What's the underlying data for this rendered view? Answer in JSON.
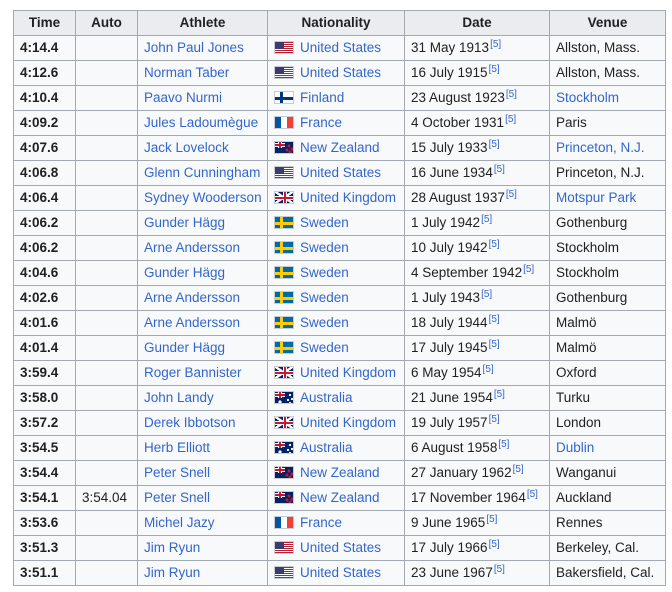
{
  "colors": {
    "header_bg": "#eaecf0",
    "cell_bg": "#f8f9fa",
    "border": "#a2a9b1",
    "link": "#3366cc",
    "text": "#202122"
  },
  "table": {
    "headers": [
      "Time",
      "Auto",
      "Athlete",
      "Nationality",
      "Date",
      "Venue"
    ],
    "rows": [
      {
        "time": "4:14.4",
        "auto": "",
        "athlete": "John Paul Jones",
        "nationality": "United States",
        "flag": "flag-us",
        "date": "31 May 1913",
        "ref": "[5]",
        "venue": "Allston, Mass.",
        "venue_link": false
      },
      {
        "time": "4:12.6",
        "auto": "",
        "athlete": "Norman Taber",
        "nationality": "United States",
        "flag": "flag-us",
        "date": "16 July 1915",
        "ref": "[5]",
        "venue": "Allston, Mass.",
        "venue_link": false
      },
      {
        "time": "4:10.4",
        "auto": "",
        "athlete": "Paavo Nurmi",
        "nationality": "Finland",
        "flag": "flag-fi",
        "date": "23 August 1923",
        "ref": "[5]",
        "venue": "Stockholm",
        "venue_link": true
      },
      {
        "time": "4:09.2",
        "auto": "",
        "athlete": "Jules Ladoumègue",
        "nationality": "France",
        "flag": "flag-fr",
        "date": "4 October 1931",
        "ref": "[5]",
        "venue": "Paris",
        "venue_link": false
      },
      {
        "time": "4:07.6",
        "auto": "",
        "athlete": "Jack Lovelock",
        "nationality": "New Zealand",
        "flag": "flag-nz",
        "date": "15 July 1933",
        "ref": "[5]",
        "venue": "Princeton, N.J.",
        "venue_link": true
      },
      {
        "time": "4:06.8",
        "auto": "",
        "athlete": "Glenn Cunningham",
        "nationality": "United States",
        "flag": "flag-us",
        "date": "16 June 1934",
        "ref": "[5]",
        "venue": "Princeton, N.J.",
        "venue_link": false
      },
      {
        "time": "4:06.4",
        "auto": "",
        "athlete": "Sydney Wooderson",
        "nationality": "United Kingdom",
        "flag": "flag-gb",
        "date": "28 August 1937",
        "ref": "[5]",
        "venue": "Motspur Park",
        "venue_link": true
      },
      {
        "time": "4:06.2",
        "auto": "",
        "athlete": "Gunder Hägg",
        "nationality": "Sweden",
        "flag": "flag-se",
        "date": "1 July 1942",
        "ref": "[5]",
        "venue": "Gothenburg",
        "venue_link": false
      },
      {
        "time": "4:06.2",
        "auto": "",
        "athlete": "Arne Andersson",
        "nationality": "Sweden",
        "flag": "flag-se",
        "date": "10 July 1942",
        "ref": "[5]",
        "venue": "Stockholm",
        "venue_link": false
      },
      {
        "time": "4:04.6",
        "auto": "",
        "athlete": "Gunder Hägg",
        "nationality": "Sweden",
        "flag": "flag-se",
        "date": "4 September 1942",
        "ref": "[5]",
        "venue": "Stockholm",
        "venue_link": false
      },
      {
        "time": "4:02.6",
        "auto": "",
        "athlete": "Arne Andersson",
        "nationality": "Sweden",
        "flag": "flag-se",
        "date": "1 July 1943",
        "ref": "[5]",
        "venue": "Gothenburg",
        "venue_link": false
      },
      {
        "time": "4:01.6",
        "auto": "",
        "athlete": "Arne Andersson",
        "nationality": "Sweden",
        "flag": "flag-se",
        "date": "18 July 1944",
        "ref": "[5]",
        "venue": "Malmö",
        "venue_link": false
      },
      {
        "time": "4:01.4",
        "auto": "",
        "athlete": "Gunder Hägg",
        "nationality": "Sweden",
        "flag": "flag-se",
        "date": "17 July 1945",
        "ref": "[5]",
        "venue": "Malmö",
        "venue_link": false
      },
      {
        "time": "3:59.4",
        "auto": "",
        "athlete": "Roger Bannister",
        "nationality": "United Kingdom",
        "flag": "flag-gb",
        "date": "6 May 1954",
        "ref": "[5]",
        "venue": "Oxford",
        "venue_link": false
      },
      {
        "time": "3:58.0",
        "auto": "",
        "athlete": "John Landy",
        "nationality": "Australia",
        "flag": "flag-au",
        "date": "21 June 1954",
        "ref": "[5]",
        "venue": "Turku",
        "venue_link": false
      },
      {
        "time": "3:57.2",
        "auto": "",
        "athlete": "Derek Ibbotson",
        "nationality": "United Kingdom",
        "flag": "flag-gb",
        "date": "19 July 1957",
        "ref": "[5]",
        "venue": "London",
        "venue_link": false
      },
      {
        "time": "3:54.5",
        "auto": "",
        "athlete": "Herb Elliott",
        "nationality": "Australia",
        "flag": "flag-au",
        "date": "6 August 1958",
        "ref": "[5]",
        "venue": "Dublin",
        "venue_link": true
      },
      {
        "time": "3:54.4",
        "auto": "",
        "athlete": "Peter Snell",
        "nationality": "New Zealand",
        "flag": "flag-nz",
        "date": "27 January 1962",
        "ref": "[5]",
        "venue": "Wanganui",
        "venue_link": false
      },
      {
        "time": "3:54.1",
        "auto": "3:54.04",
        "athlete": "Peter Snell",
        "nationality": "New Zealand",
        "flag": "flag-nz",
        "date": "17 November 1964",
        "ref": "[5]",
        "venue": "Auckland",
        "venue_link": false
      },
      {
        "time": "3:53.6",
        "auto": "",
        "athlete": "Michel Jazy",
        "nationality": "France",
        "flag": "flag-fr",
        "date": "9 June 1965",
        "ref": "[5]",
        "venue": "Rennes",
        "venue_link": false
      },
      {
        "time": "3:51.3",
        "auto": "",
        "athlete": "Jim Ryun",
        "nationality": "United States",
        "flag": "flag-us",
        "date": "17 July 1966",
        "ref": "[5]",
        "venue": "Berkeley, Cal.",
        "venue_link": false
      },
      {
        "time": "3:51.1",
        "auto": "",
        "athlete": "Jim Ryun",
        "nationality": "United States",
        "flag": "flag-us",
        "date": "23 June 1967",
        "ref": "[5]",
        "venue": "Bakersfield, Cal.",
        "venue_link": false
      }
    ]
  }
}
